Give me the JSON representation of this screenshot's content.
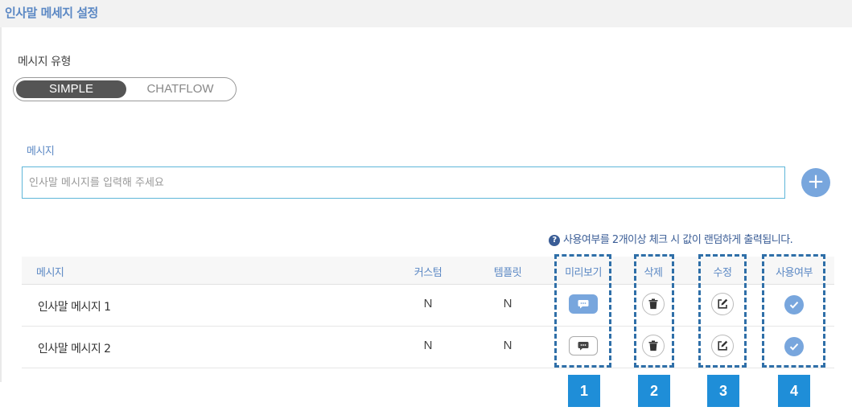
{
  "page": {
    "title": "인사말 메세지 설정"
  },
  "message_type": {
    "label": "메시지 유형",
    "options": [
      "SIMPLE",
      "CHATFLOW"
    ],
    "selected": "SIMPLE"
  },
  "message_input": {
    "label": "메시지",
    "placeholder": "인사말 메시지를 입력해 주세요",
    "value": "",
    "add_icon": "plus-icon"
  },
  "notice": {
    "icon": "question-icon",
    "icon_glyph": "?",
    "text": "사용여부를 2개이상 체크 시 값이 랜덤하게 출력됩니다."
  },
  "table": {
    "columns": [
      "메시지",
      "커스텀",
      "템플릿",
      "미리보기",
      "삭제",
      "수정",
      "사용여부"
    ],
    "rows": [
      {
        "message": "인사말 메시지 1",
        "custom": "N",
        "template": "N",
        "preview_active": true,
        "in_use": true
      },
      {
        "message": "인사말 메시지 2",
        "custom": "N",
        "template": "N",
        "preview_active": false,
        "in_use": true
      }
    ]
  },
  "annotations": [
    "1",
    "2",
    "3",
    "4"
  ],
  "colors": {
    "accent": "#78a6dd",
    "title": "#5b88c4",
    "notice": "#3a5d96",
    "dash_border": "#2f6fa8",
    "marker_bg": "#1f8ed8",
    "toggle_active": "#555555"
  },
  "icons": {
    "preview": "chat-bubble-icon",
    "delete": "trash-icon",
    "edit": "edit-icon",
    "in_use": "check-circle-icon"
  }
}
